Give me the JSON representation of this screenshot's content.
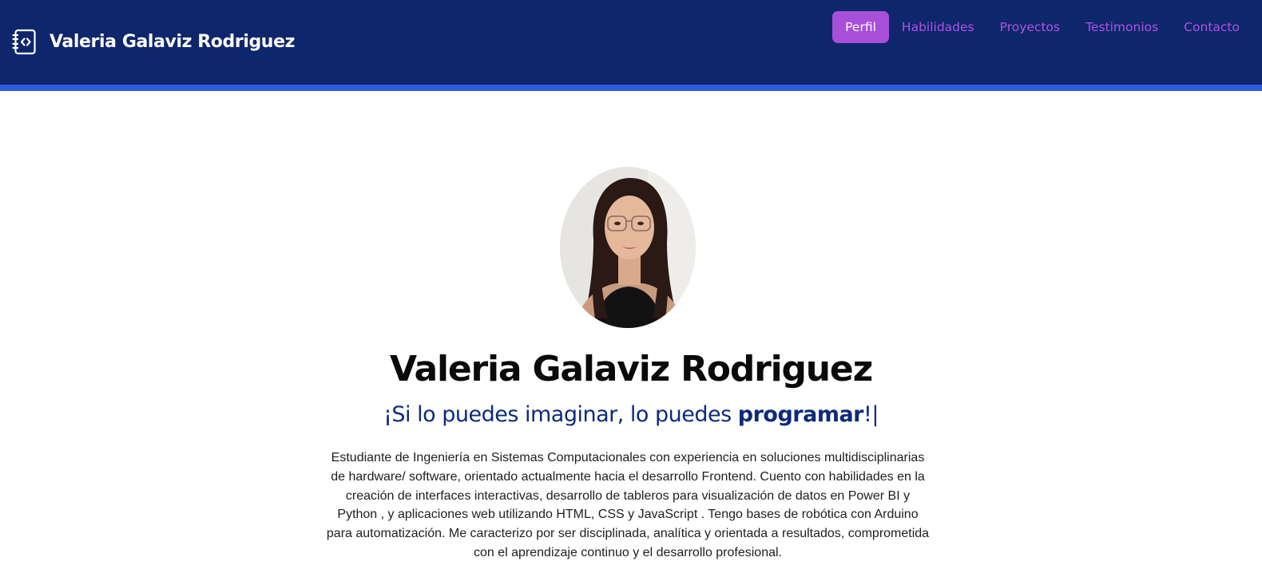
{
  "brand": {
    "icon": "code-notebook-icon",
    "title": "Valeria Galaviz Rodriguez"
  },
  "nav": {
    "items": [
      {
        "label": "Perfil",
        "active": true
      },
      {
        "label": "Habilidades",
        "active": false
      },
      {
        "label": "Proyectos",
        "active": false
      },
      {
        "label": "Testimonios",
        "active": false
      },
      {
        "label": "Contacto",
        "active": false
      }
    ]
  },
  "hero": {
    "photo": "profile-photo",
    "name": "Valeria Galaviz Rodriguez",
    "tagline_prefix": "¡Si lo puedes imaginar, lo puedes ",
    "tagline_emphasis": "programar",
    "tagline_suffix": "!|",
    "bio": "Estudiante de Ingeniería en Sistemas Computacionales con experiencia en soluciones multidisciplinarias de hardware/ software, orientado actualmente hacia el desarrollo Frontend. Cuento con habilidades en la creación de interfaces interactivas, desarrollo de tableros para visualización de datos en Power BI y Python , y aplicaciones web utilizando HTML, CSS y JavaScript . Tengo bases de robótica con Arduino para automatización. Me caracterizo por ser disciplinada, analítica y orientada a resultados, comprometida con el aprendizaje continuo y el desarrollo profesional."
  },
  "colors": {
    "navbar_bg": "#0e266b",
    "navbar_stripe": "#2f5be0",
    "nav_link": "#b153e6",
    "nav_active_bg": "#a84fd9",
    "tagline": "#0e2a7a"
  }
}
